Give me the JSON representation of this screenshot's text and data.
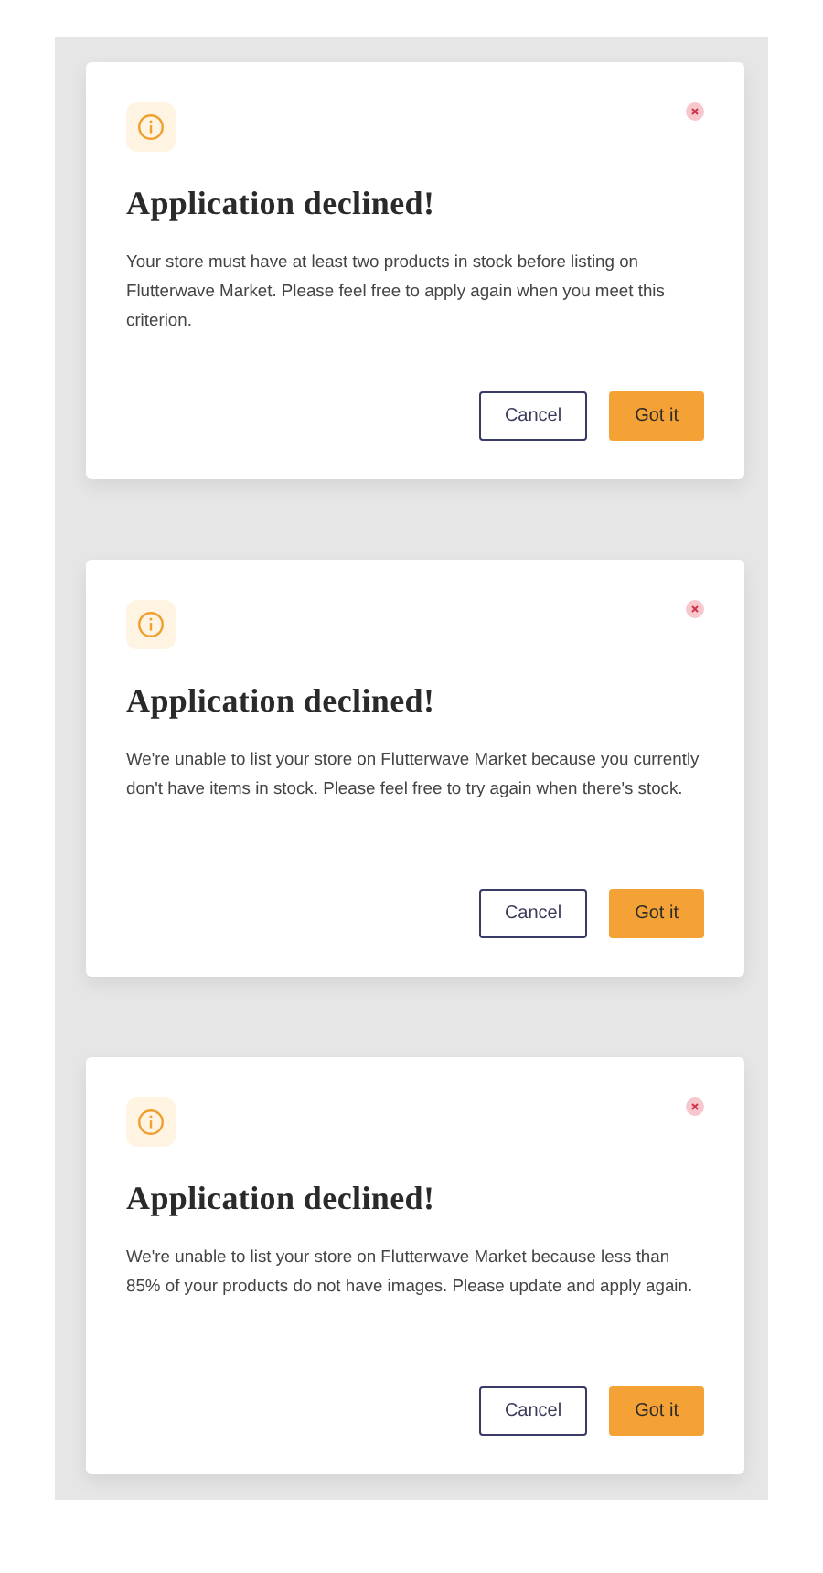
{
  "dialogs": [
    {
      "title": "Application declined!",
      "message": "Your store must have at least two products in stock before listing on Flutterwave Market.  Please feel free to apply again when you meet this criterion.",
      "buttons": [
        "Cancel",
        "Got it"
      ]
    },
    {
      "title": "Application declined!",
      "message": "We're unable to list your store on Flutterwave Market because you currently don't have items in stock. Please feel free to try again when there's stock.",
      "buttons": [
        "Cancel",
        "Got it"
      ]
    },
    {
      "title": "Application declined!",
      "message": "We're unable to list your store on Flutterwave Market because less than 85% of your products do not have images. Please update and apply again.",
      "buttons": [
        "Cancel",
        "Got it"
      ]
    }
  ]
}
